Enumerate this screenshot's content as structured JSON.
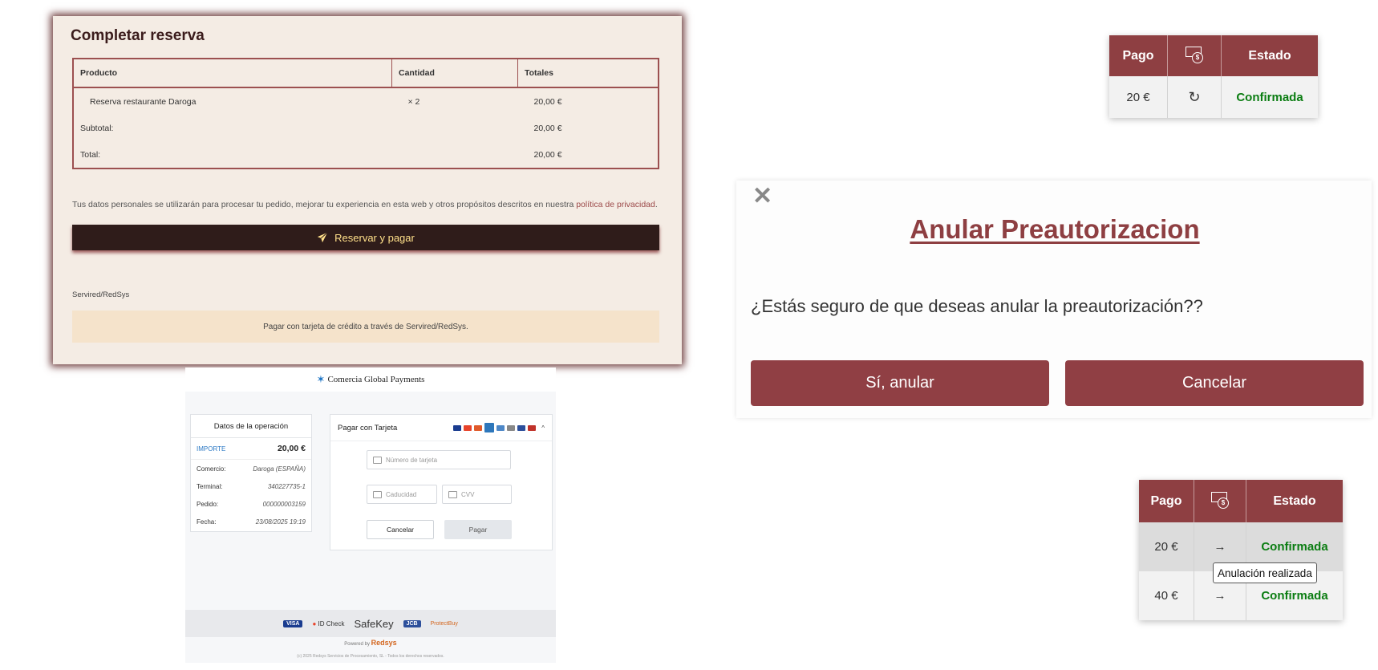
{
  "reserva": {
    "title": "Completar reserva",
    "headers": {
      "producto": "Producto",
      "cantidad": "Cantidad",
      "totales": "Totales"
    },
    "item": {
      "name": "Reserva restaurante Daroga",
      "qty": "× 2",
      "total": "20,00 €"
    },
    "subtotal": {
      "label": "Subtotal:",
      "value": "20,00 €"
    },
    "total": {
      "label": "Total:",
      "value": "20,00 €"
    },
    "privacy_text": "Tus datos personales se utilizarán para procesar tu pedido, mejorar tu experiencia en esta web y otros propósitos descritos en nuestra ",
    "privacy_link": "política de privacidad",
    "pay_button": "Reservar y pagar",
    "gateway_title": "Servired/RedSys",
    "gateway_desc": "Pagar con tarjeta de crédito a través de Servired/RedSys."
  },
  "redsys": {
    "brand": "Comercia Global Payments",
    "ops_title": "Datos de la operación",
    "importe_label": "IMPORTE",
    "importe_value": "20,00 €",
    "rows": [
      {
        "label": "Comercio:",
        "value": "Daroga (ESPAÑA)"
      },
      {
        "label": "Terminal:",
        "value": "340227735-1"
      },
      {
        "label": "Pedido:",
        "value": "000000003159"
      },
      {
        "label": "Fecha:",
        "value": "23/08/2025   19:19"
      }
    ],
    "card_title": "Pagar con Tarjeta",
    "card_number_placeholder": "Número de tarjeta",
    "expiry_placeholder": "Caducidad",
    "cvv_placeholder": "CVV",
    "cancel_label": "Cancelar",
    "pay_label": "Pagar",
    "footer_logos": [
      "VISA",
      "ID Check",
      "SafeKey",
      "JCB",
      "ProtectBuy"
    ],
    "powered_by": "Powered by",
    "powered_brand": "Redsys",
    "copyright": "(c) 2025 Redsys Servicios de Procesamiento, SL - Todos los derechos reservados."
  },
  "status_top": {
    "headers": {
      "pago": "Pago",
      "estado": "Estado"
    },
    "row": {
      "pago": "20 €",
      "icon": "↻",
      "estado": "Confirmada"
    }
  },
  "status_bottom": {
    "headers": {
      "pago": "Pago",
      "estado": "Estado"
    },
    "rows": [
      {
        "pago": "20 €",
        "icon": "→",
        "estado": "Confirmada"
      },
      {
        "pago": "40 €",
        "icon": "→",
        "estado": "Confirmada"
      }
    ],
    "tooltip": "Anulación realizada"
  },
  "dialog": {
    "close": "✕",
    "title": "Anular Preautorizacion",
    "question": "¿Estás seguro de que deseas anular la preautorización??",
    "confirm": "Sí, anular",
    "cancel": "Cancelar"
  },
  "colors": {
    "brand": "#8e3f42",
    "dark_button": "#2f1c1a",
    "confirmed": "#0b7d12"
  },
  "icons": {
    "close": "close-icon",
    "send": "paper-plane-icon",
    "refresh": "refresh-icon",
    "arrow": "arrow-right-icon",
    "money": "money-coin-icon"
  }
}
